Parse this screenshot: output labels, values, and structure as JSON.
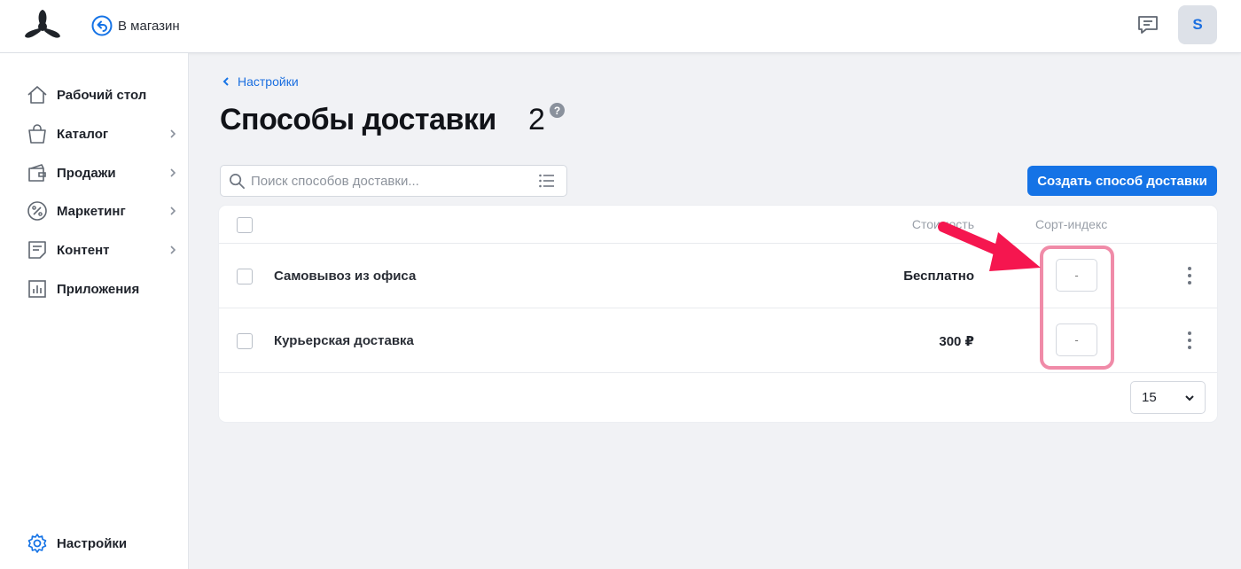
{
  "header": {
    "back_to_store": "В магазин",
    "avatar_initial": "S"
  },
  "sidebar": {
    "items": [
      {
        "label": "Рабочий стол",
        "icon": "home-icon",
        "has_submenu": false
      },
      {
        "label": "Каталог",
        "icon": "shopping-bag-icon",
        "has_submenu": true
      },
      {
        "label": "Продажи",
        "icon": "wallet-icon",
        "has_submenu": true
      },
      {
        "label": "Маркетинг",
        "icon": "percent-icon",
        "has_submenu": true
      },
      {
        "label": "Контент",
        "icon": "document-icon",
        "has_submenu": true
      },
      {
        "label": "Приложения",
        "icon": "chart-icon",
        "has_submenu": false
      }
    ],
    "settings_label": "Настройки"
  },
  "breadcrumb": {
    "label": "Настройки"
  },
  "page": {
    "title": "Способы доставки",
    "count": "2",
    "help": "?"
  },
  "search": {
    "placeholder": "Поиск способов доставки...",
    "value": ""
  },
  "actions": {
    "create_label": "Создать способ доставки"
  },
  "table": {
    "headers": {
      "price": "Стоимость",
      "sort": "Сорт-индекс"
    },
    "rows": [
      {
        "name": "Самовывоз из офиса",
        "price": "Бесплатно",
        "sort_placeholder": "-"
      },
      {
        "name": "Курьерская доставка",
        "price": "300 ₽",
        "sort_placeholder": "-"
      }
    ]
  },
  "pagination": {
    "per_page": "15"
  },
  "colors": {
    "accent": "#1573e6",
    "highlight": "#f08ba8",
    "arrow": "#f5164f"
  }
}
